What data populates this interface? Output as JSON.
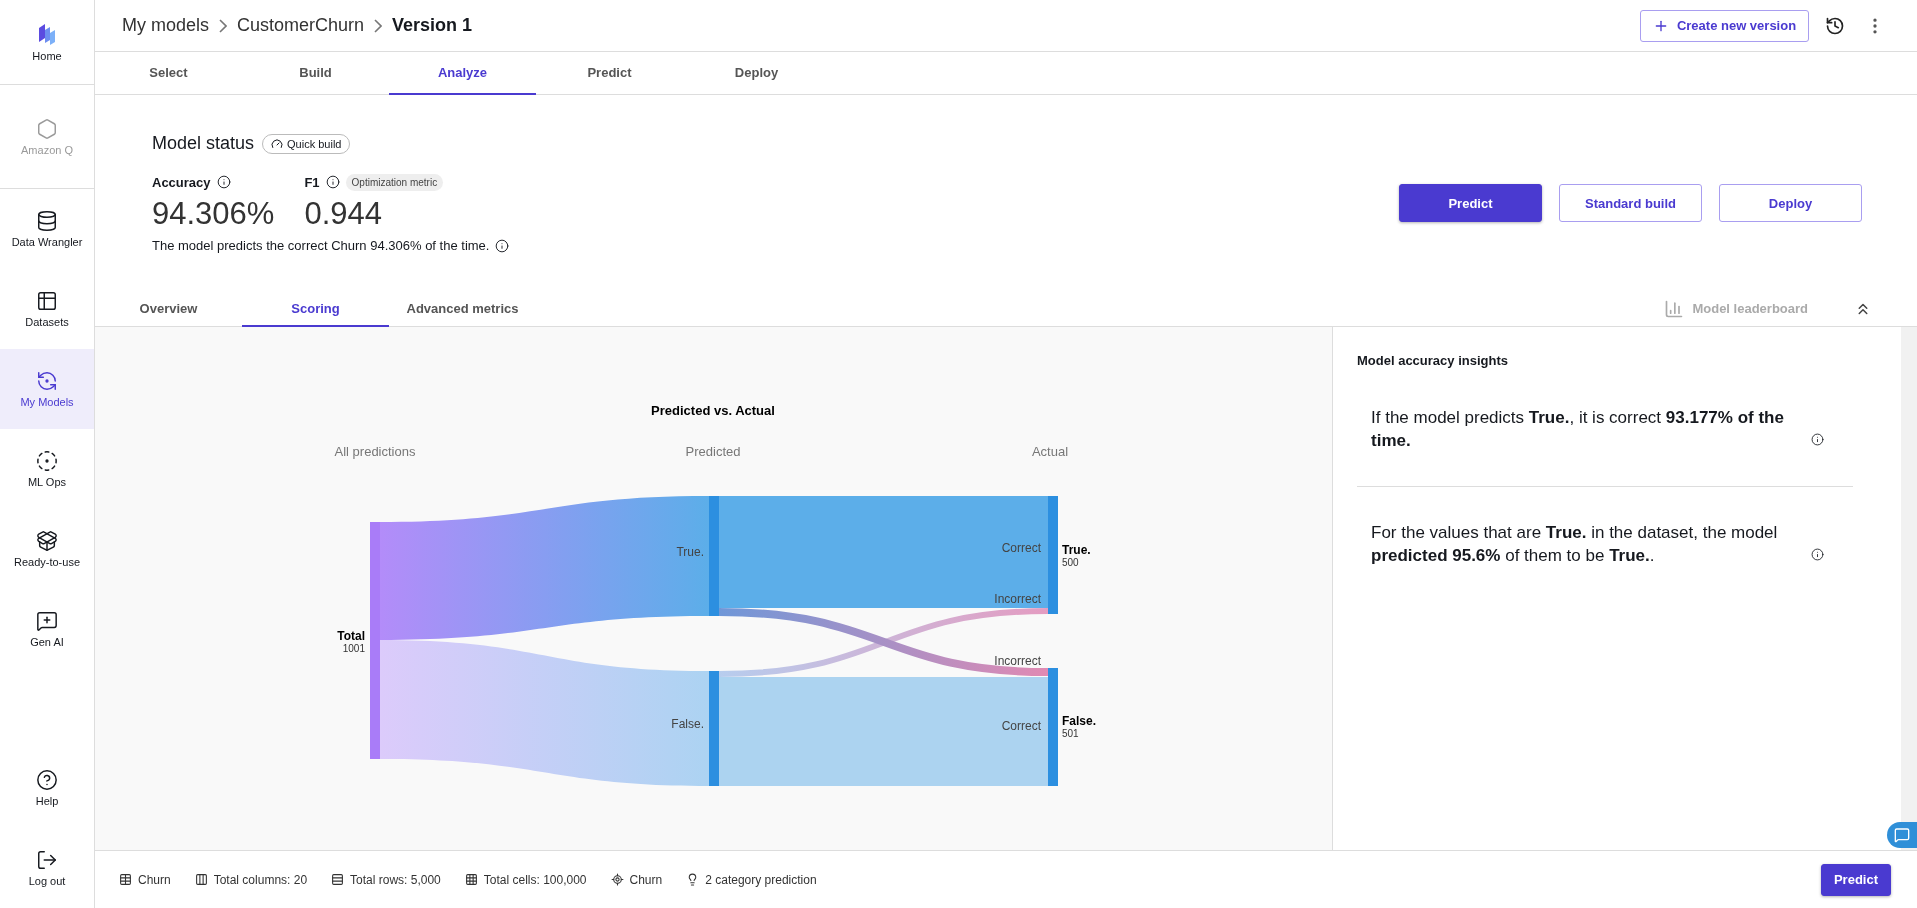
{
  "sidebar": {
    "items": [
      {
        "kind": "home",
        "label": "Home",
        "selected": false,
        "disabled": false
      },
      {
        "kind": "assistant",
        "label": "Amazon Q",
        "selected": false,
        "disabled": true
      },
      {
        "kind": "wrangler",
        "label": "Data Wrangler",
        "selected": false,
        "disabled": false
      },
      {
        "kind": "datasets",
        "label": "Datasets",
        "selected": false,
        "disabled": false
      },
      {
        "kind": "models",
        "label": "My Models",
        "selected": true,
        "disabled": false
      },
      {
        "kind": "mlops",
        "label": "ML Ops",
        "selected": false,
        "disabled": false
      },
      {
        "kind": "ready",
        "label": "Ready-to-use",
        "selected": false,
        "disabled": false
      },
      {
        "kind": "genai",
        "label": "Gen AI",
        "selected": false,
        "disabled": false
      }
    ],
    "footer_items": [
      {
        "kind": "help",
        "label": "Help"
      },
      {
        "kind": "logout",
        "label": "Log out"
      }
    ]
  },
  "breadcrumb": [
    "My models",
    "CustomerChurn",
    "Version 1"
  ],
  "header": {
    "create_button": "Create new version"
  },
  "steps": [
    {
      "label": "Select",
      "selected": false
    },
    {
      "label": "Build",
      "selected": false
    },
    {
      "label": "Analyze",
      "selected": true
    },
    {
      "label": "Predict",
      "selected": false
    },
    {
      "label": "Deploy",
      "selected": false
    }
  ],
  "model_status": {
    "title": "Model status",
    "build_badge": "Quick build",
    "metrics": [
      {
        "label": "Accuracy",
        "value": "94.306%"
      },
      {
        "label": "F1",
        "value": "0.944",
        "badge": "Optimization metric"
      }
    ],
    "description": "The model predicts the correct Churn 94.306% of the time."
  },
  "actions": [
    {
      "kind": "primary",
      "label": "Predict"
    },
    {
      "kind": "secondary",
      "label": "Standard build"
    },
    {
      "kind": "secondary",
      "label": "Deploy"
    }
  ],
  "result_tabs": [
    {
      "label": "Overview",
      "selected": false
    },
    {
      "label": "Scoring",
      "selected": true
    },
    {
      "label": "Advanced metrics",
      "selected": false
    }
  ],
  "leaderboard": {
    "label": "Model leaderboard",
    "disabled": true
  },
  "sankey": {
    "title": "Predicted vs. Actual",
    "column_headers": [
      "All predictions",
      "Predicted",
      "Actual"
    ],
    "total": {
      "label": "Total",
      "count": "1001"
    },
    "predicted": [
      "True.",
      "False."
    ],
    "actual": [
      {
        "label": "True.",
        "count": "500",
        "correct_label": "Correct",
        "incorrect_label": "Incorrect"
      },
      {
        "label": "False.",
        "count": "501",
        "correct_label": "Correct",
        "incorrect_label": "Incorrect"
      }
    ]
  },
  "insights": {
    "title": "Model accuracy insights",
    "items": [
      "If the model predicts **True.**, it is correct **93.177% of the time.**",
      "For the values that are **True.** in the dataset, the model **predicted 95.6%** of them to be **True.**."
    ]
  },
  "status_bar": {
    "items": [
      {
        "kind": "table",
        "label": "Churn"
      },
      {
        "kind": "columns",
        "label": "Total columns: 20"
      },
      {
        "kind": "rows",
        "label": "Total rows: 5,000"
      },
      {
        "kind": "cells",
        "label": "Total cells: 100,000"
      },
      {
        "kind": "target",
        "label": "Churn"
      },
      {
        "kind": "prediction",
        "label": "2 category prediction"
      }
    ],
    "predict_button": "Predict"
  }
}
